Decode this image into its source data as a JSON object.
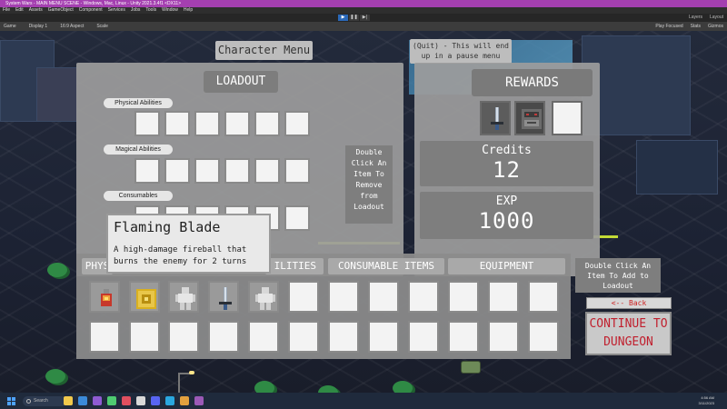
{
  "editor": {
    "window_title": "System Wars - MAIN MENU SCENE - Windows, Mac, Linux - Unity 2021.3.4f1 <DX11>",
    "menu": [
      "File",
      "Edit",
      "Assets",
      "GameObject",
      "Component",
      "Services",
      "Jobs",
      "Tools",
      "Window",
      "Help"
    ],
    "play_buttons": [
      "▶",
      "❚❚",
      "▶|"
    ],
    "toolbar_right": [
      "Layers",
      "Layout"
    ],
    "game_tab": "Game",
    "display": "Display 1",
    "aspect": "16:9 Aspect",
    "scale": "Scale",
    "game_right": [
      "Play Focused",
      "Stats",
      "Gizmos"
    ]
  },
  "character_menu": {
    "title": "Character Menu",
    "quit_note": "(Quit) - This will end up in a pause menu",
    "loadout": {
      "title": "LOADOUT",
      "rows": [
        "Physical Abilities",
        "Magical Abilities",
        "Consumables"
      ],
      "hint": "Double Click An Item To Remove from Loadout"
    },
    "rewards": {
      "title": "REWARDS",
      "credits_label": "Credits",
      "credits_value": "12",
      "exp_label": "EXP",
      "exp_value": "1000",
      "items": [
        "sword-icon",
        "robot-chest-icon",
        "empty"
      ]
    },
    "inventory": {
      "tabs": [
        "PHYSICAL ABILITIES",
        "MAGICAL ABILITIES",
        "CONSUMABLE ITEMS",
        "EQUIPMENT"
      ],
      "visible_tab_fragments": [
        "PHYS",
        "ILITIES"
      ],
      "items": [
        "flame-potion-icon",
        "golden-crate-icon",
        "armor-suit-icon",
        "sword-icon",
        "armor-suit-icon"
      ],
      "hint": "Double Click An Item To Add to Loadout"
    },
    "tooltip": {
      "title": "Flaming Blade",
      "description": "A high-damage fireball that burns the enemy for 2 turns"
    },
    "back_label": "<-- Back",
    "continue_label": "CONTINUE TO DUNGEON",
    "colors": {
      "panel": "#9c9c9c",
      "continue_text": "#c0202e",
      "neon": "#c2d936"
    }
  },
  "taskbar": {
    "search": "Search",
    "time": "4:56 AM",
    "date": "3/11/2023"
  }
}
